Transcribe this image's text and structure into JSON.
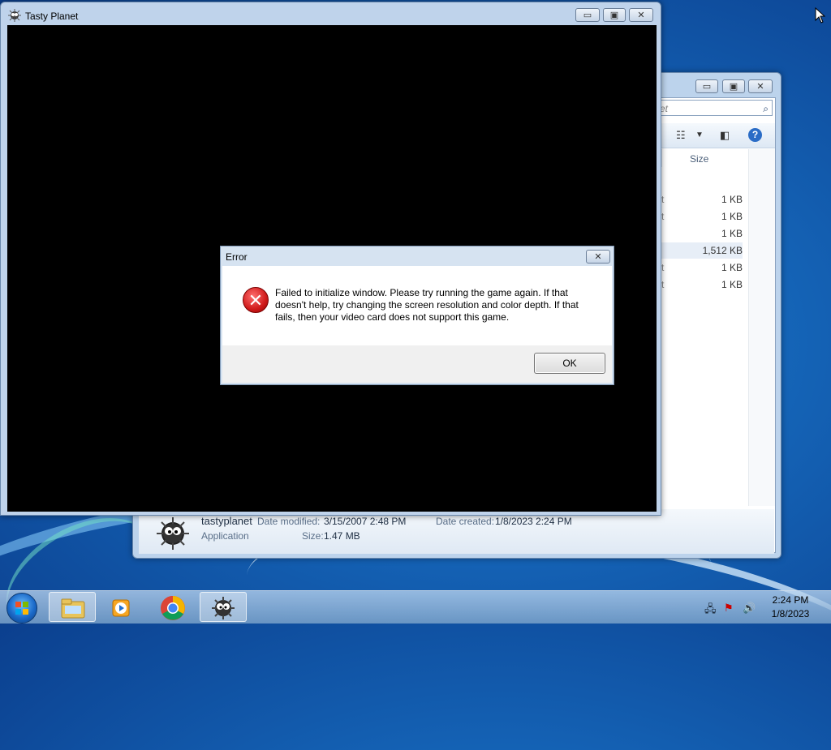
{
  "game_window": {
    "title": "Tasty Planet",
    "minimize": "▭",
    "maximize": "▣",
    "close": "✕"
  },
  "explorer": {
    "search_placeholder": "et",
    "column_size": "Size",
    "sizes": [
      "1 KB",
      "1 KB",
      "1 KB",
      "1,512 KB",
      "1 KB",
      "1 KB"
    ],
    "details": {
      "name": "tastyplanet",
      "type": "Application",
      "date_modified_label": "Date modified:",
      "date_modified": "3/15/2007 2:48 PM",
      "date_created_label": "Date created:",
      "date_created": "1/8/2023 2:24 PM",
      "size_label": "Size:",
      "size": "1.47 MB"
    }
  },
  "dialog": {
    "title": "Error",
    "message": "Failed to initialize window. Please try running the game again. If that doesn't help, try changing the screen resolution and color depth. If that fails, then your video card does not support this game.",
    "ok_label": "OK",
    "close": "✕"
  },
  "taskbar": {
    "time": "2:24 PM",
    "date": "1/8/2023"
  }
}
